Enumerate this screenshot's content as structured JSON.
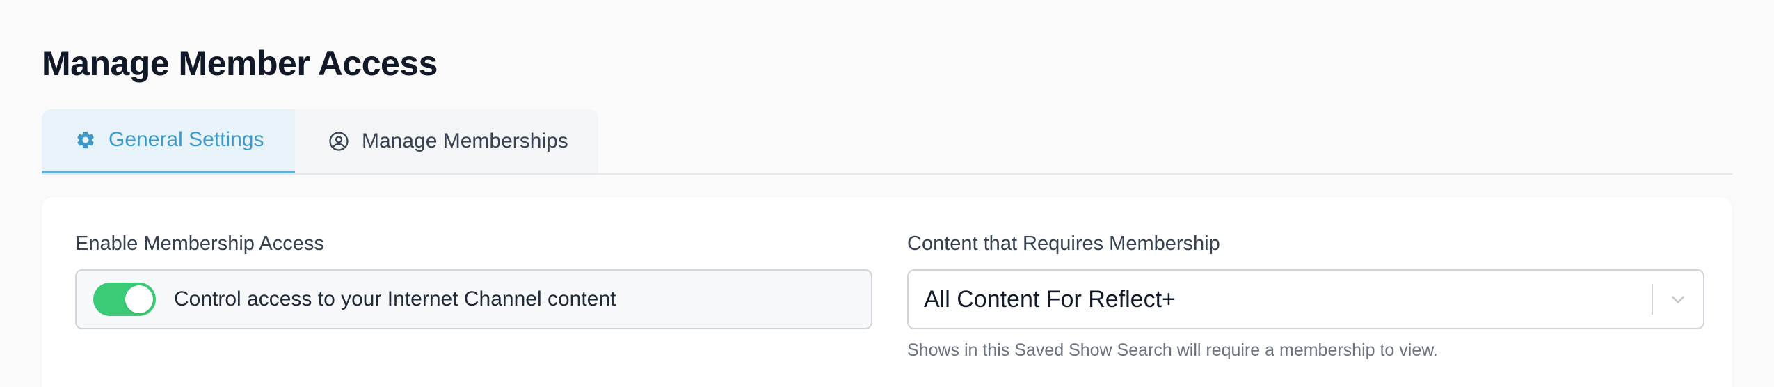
{
  "page": {
    "title": "Manage Member Access"
  },
  "tabs": [
    {
      "label": "General Settings",
      "icon": "gear-icon",
      "active": true
    },
    {
      "label": "Manage Memberships",
      "icon": "user-circle-icon",
      "active": false
    }
  ],
  "membership_access": {
    "label": "Enable Membership Access",
    "toggle_on": true,
    "toggle_text": "Control access to your Internet Channel content"
  },
  "content_requirement": {
    "label": "Content that Requires Membership",
    "selected_value": "All Content For Reflect+",
    "help_text": "Shows in this Saved Show Search will require a membership to view."
  },
  "colors": {
    "accent": "#3d9ac8",
    "toggle_on": "#3bca75",
    "title": "#111827"
  }
}
